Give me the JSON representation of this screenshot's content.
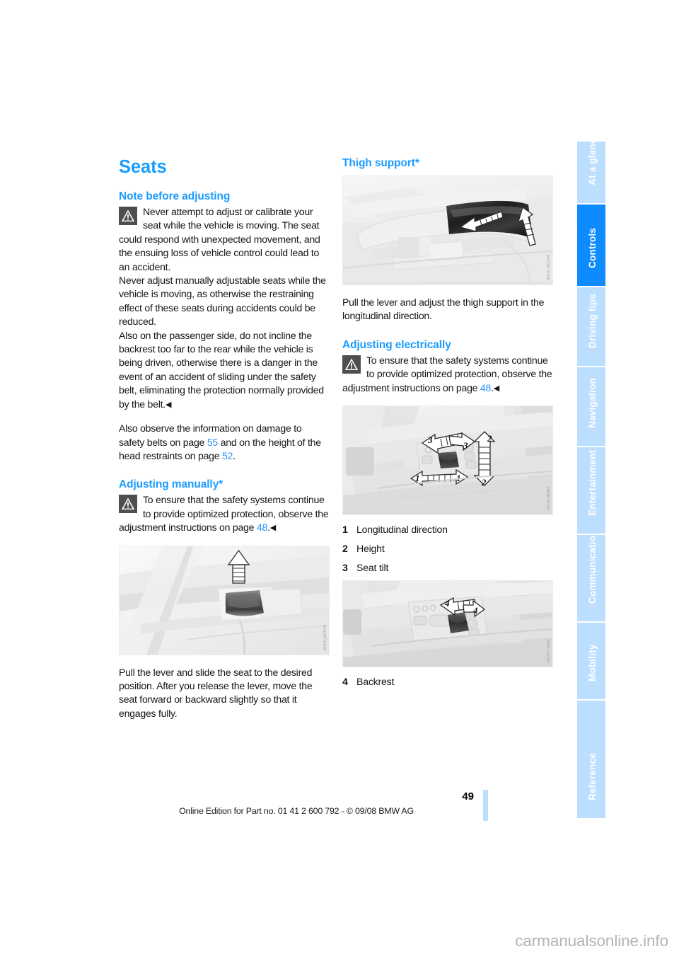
{
  "document": {
    "chapter_title": "Seats",
    "page_number": "49",
    "edition_line": "Online Edition for Part no. 01 41 2 600 792 - © 09/08 BMW AG",
    "watermark": "carmanualsonline.info",
    "accent_color": "#1b9cff",
    "link_color": "#2a8fff",
    "tab_active_color": "#0d8bff",
    "tab_inactive_color": "#bcdeff"
  },
  "sidebar": {
    "tabs": [
      {
        "label": "At a glance",
        "active": false
      },
      {
        "label": "Controls",
        "active": true
      },
      {
        "label": "Driving tips",
        "active": false
      },
      {
        "label": "Navigation",
        "active": false
      },
      {
        "label": "Entertainment",
        "active": false
      },
      {
        "label": "Communications",
        "active": false
      },
      {
        "label": "Mobility",
        "active": false
      },
      {
        "label": "Reference",
        "active": false
      }
    ]
  },
  "left_column": {
    "section_1": {
      "heading": "Note before adjusting",
      "warning_icon": "warning-triangle-icon",
      "warning_text": "Never attempt to adjust or calibrate your seat while the vehicle is moving. The seat could respond with unexpected movement, and the ensuing loss of vehicle control could lead to an accident.",
      "warning_text_2": "Never adjust manually adjustable seats while the vehicle is moving, as otherwise the restraining effect of these seats during accidents could be reduced.",
      "warning_text_3": "Also on the passenger side, do not incline the backrest too far to the rear while the vehicle is being driven, otherwise there is a danger in the event of an accident of sliding under the safety belt, eliminating the protection normally provided by the belt.",
      "note_prefix": "Also observe the information on damage to safety belts on page ",
      "note_link_1": "55",
      "note_middle": " and on the height of the head restraints on page ",
      "note_link_2": "52",
      "note_suffix": "."
    },
    "section_2": {
      "heading": "Adjusting manually*",
      "warning_icon": "warning-triangle-icon",
      "warning_prefix": "To ensure that the safety systems continue to provide optimized protection, observe the adjustment instructions on page ",
      "warning_link": "48",
      "warning_suffix": ".",
      "figure": {
        "name": "manual-seat-lever-illustration",
        "code": "WCH_MC505"
      },
      "caption": "Pull the lever and slide the seat to the desired position. After you release the lever, move the seat forward or backward slightly so that it engages fully."
    }
  },
  "right_column": {
    "section_1": {
      "heading": "Thigh support*",
      "figure": {
        "name": "thigh-support-illustration",
        "code": "WCH_MC504"
      },
      "caption": "Pull the lever and adjust the thigh support in the longitudinal direction."
    },
    "section_2": {
      "heading": "Adjusting electrically",
      "warning_icon": "warning-triangle-icon",
      "warning_prefix": "To ensure that the safety systems continue to provide optimized protection, observe the adjustment instructions on page ",
      "warning_link": "48",
      "warning_suffix": ".",
      "figure": {
        "name": "electric-seat-controls-illustration",
        "code": "WC2C0R045",
        "arrow_labels": [
          "1",
          "1",
          "2",
          "2",
          "3",
          "3"
        ]
      },
      "legend": [
        {
          "num": "1",
          "text": "Longitudinal direction"
        },
        {
          "num": "2",
          "text": "Height"
        },
        {
          "num": "3",
          "text": "Seat tilt"
        }
      ],
      "figure_2": {
        "name": "backrest-control-illustration",
        "code": "WC4T1S045",
        "arrow_labels": [
          "4",
          "4"
        ]
      },
      "legend_2": [
        {
          "num": "4",
          "text": "Backrest"
        }
      ]
    }
  }
}
